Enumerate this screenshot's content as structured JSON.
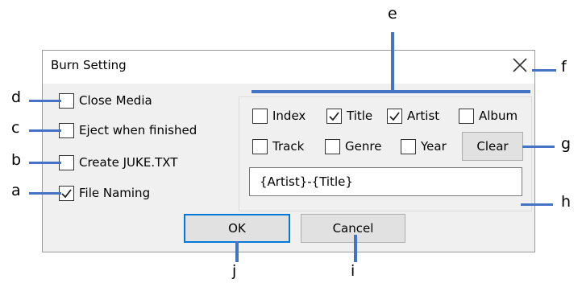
{
  "window": {
    "title": "Burn Setting",
    "close_icon": "close-icon"
  },
  "options": [
    {
      "label": "Close Media",
      "checked": false
    },
    {
      "label": "Eject when finished",
      "checked": false
    },
    {
      "label": "Create JUKE.TXT",
      "checked": false
    },
    {
      "label": "File Naming",
      "checked": true
    }
  ],
  "fields": [
    {
      "label": "Index",
      "checked": false
    },
    {
      "label": "Title",
      "checked": true
    },
    {
      "label": "Artist",
      "checked": true
    },
    {
      "label": "Album",
      "checked": false
    },
    {
      "label": "Track",
      "checked": false
    },
    {
      "label": "Genre",
      "checked": false
    },
    {
      "label": "Year",
      "checked": false
    }
  ],
  "clear_label": "Clear",
  "naming_value": "{Artist}-{Title}",
  "ok_label": "OK",
  "cancel_label": "Cancel",
  "callouts": {
    "a": "a",
    "b": "b",
    "c": "c",
    "d": "d",
    "e": "e",
    "f": "f",
    "g": "g",
    "h": "h",
    "i": "i",
    "j": "j"
  },
  "colors": {
    "callout_line": "#4472c4",
    "default_button_border": "#0078d7"
  }
}
